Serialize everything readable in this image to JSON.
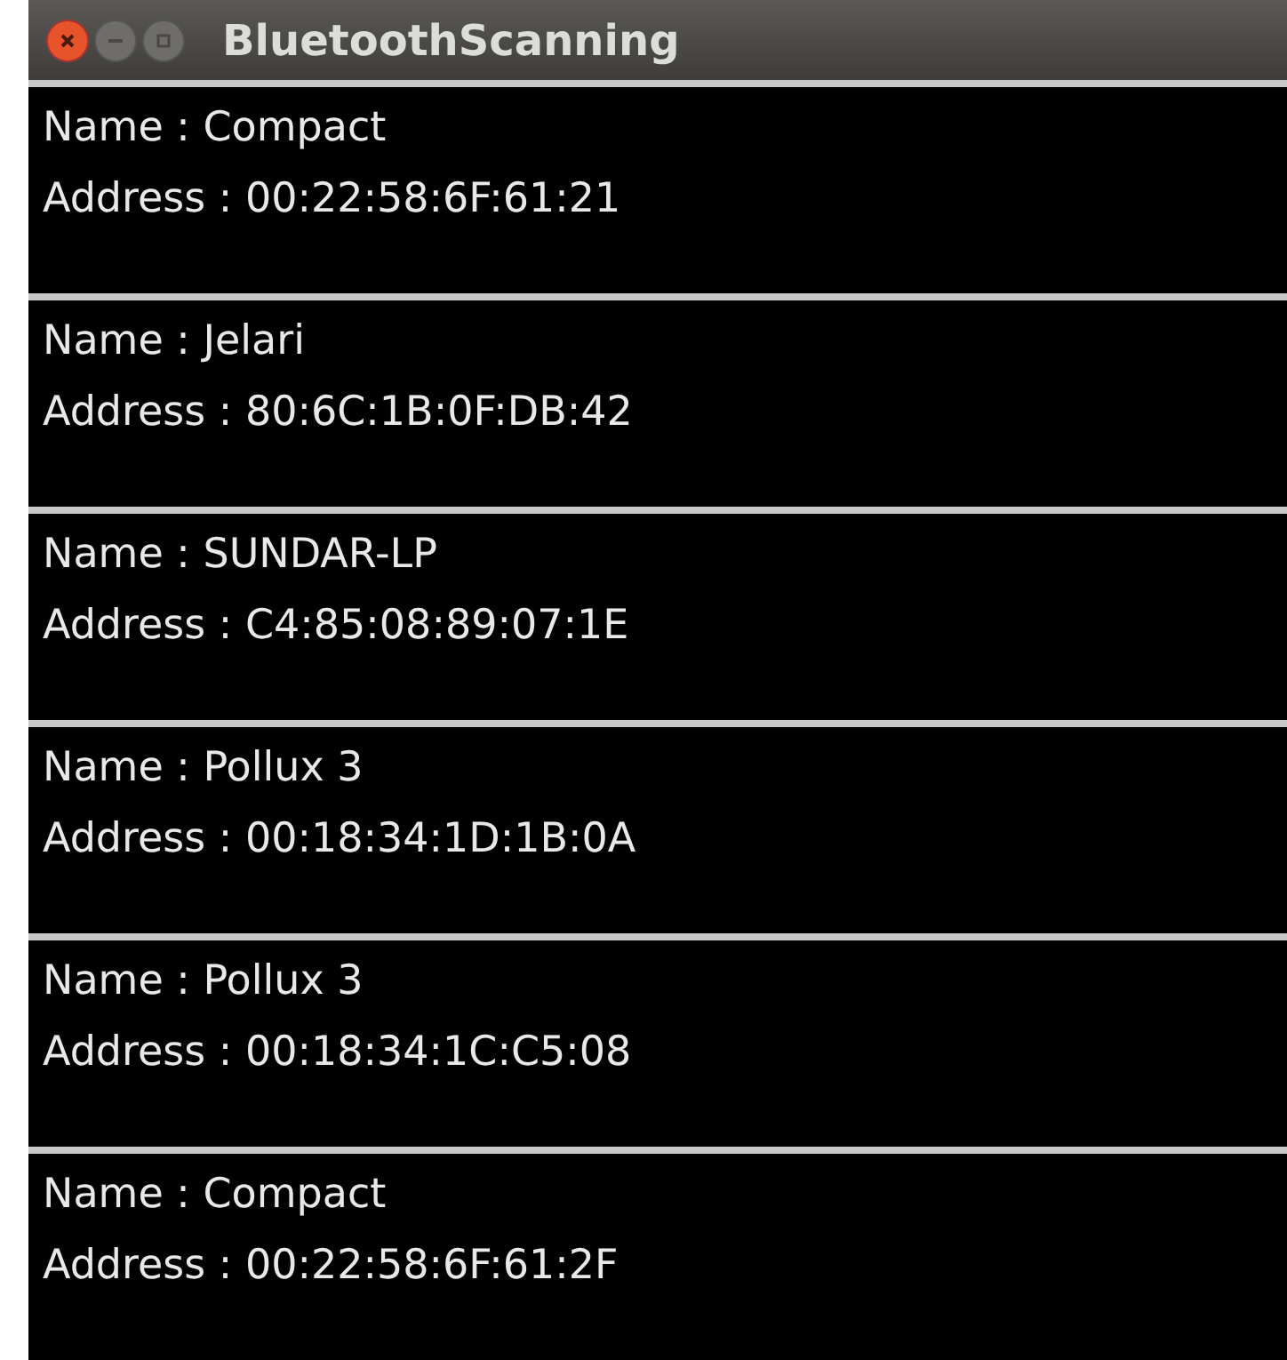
{
  "window": {
    "title": "BluetoothScanning"
  },
  "devices": [
    {
      "name": "Name : Compact",
      "address": "Address : 00:22:58:6F:61:21"
    },
    {
      "name": "Name : Jelari",
      "address": "Address : 80:6C:1B:0F:DB:42"
    },
    {
      "name": "Name : SUNDAR-LP",
      "address": "Address : C4:85:08:89:07:1E"
    },
    {
      "name": "Name : Pollux 3",
      "address": "Address : 00:18:34:1D:1B:0A"
    },
    {
      "name": "Name : Pollux 3",
      "address": "Address : 00:18:34:1C:C5:08"
    },
    {
      "name": "Name : Compact",
      "address": "Address : 00:22:58:6F:61:2F"
    }
  ]
}
